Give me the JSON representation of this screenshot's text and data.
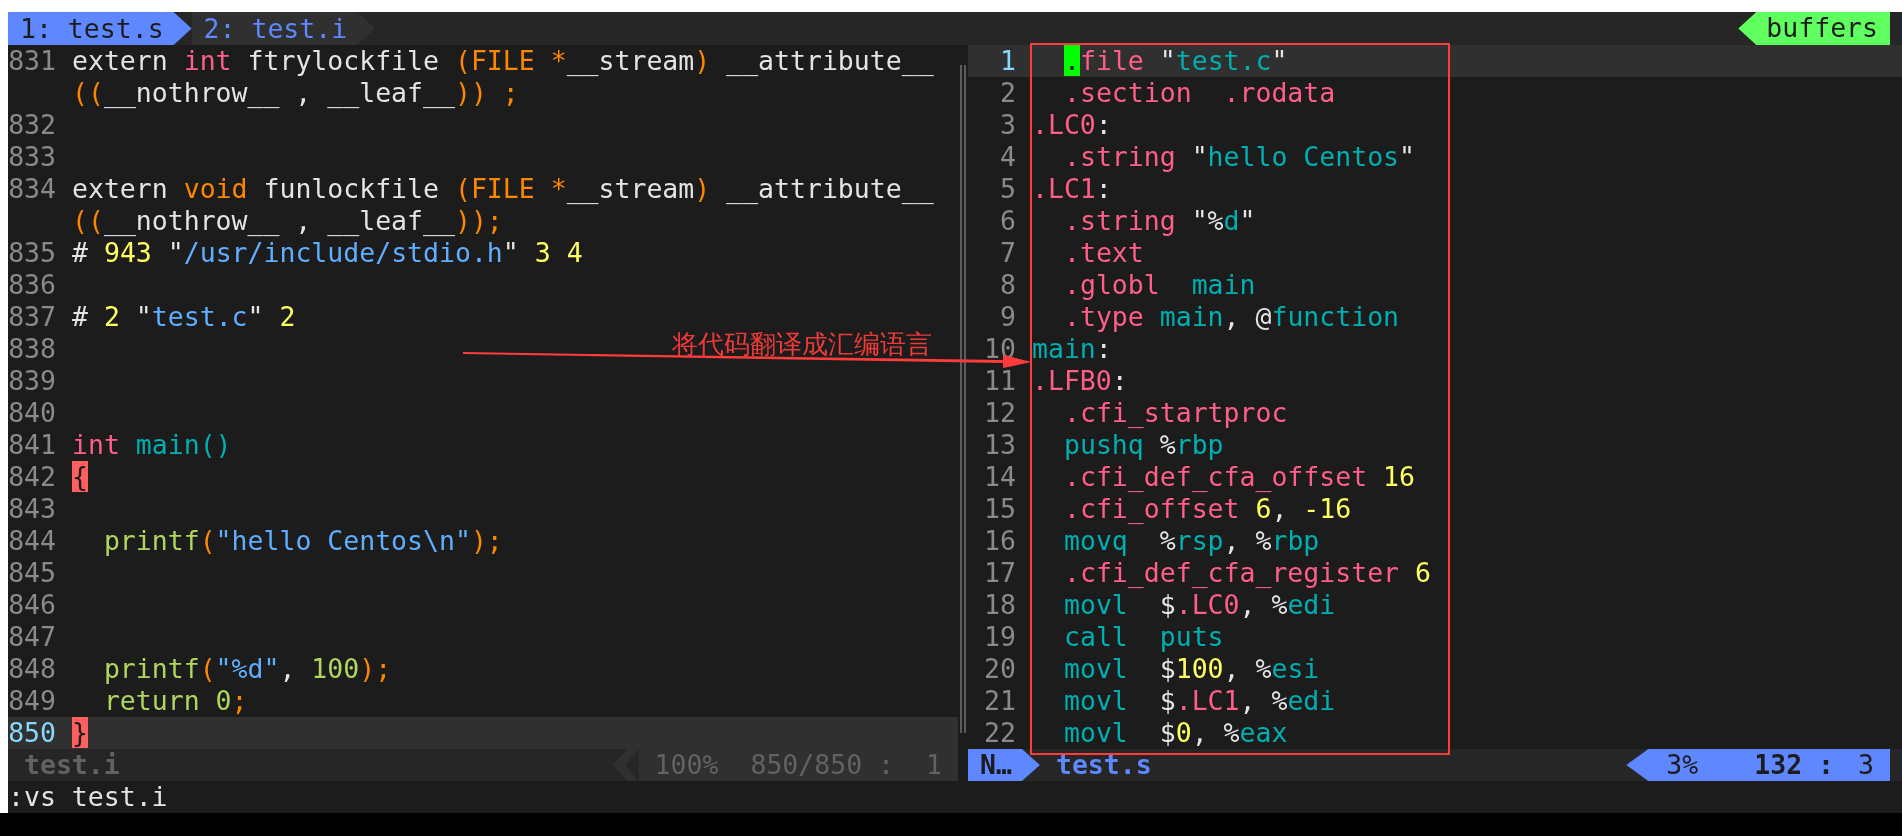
{
  "tabline": {
    "tabs": [
      {
        "label": "1: test.s",
        "selected": true
      },
      {
        "label": "2: test.i",
        "selected": false
      }
    ],
    "buffers_label": "buffers"
  },
  "left_pane": {
    "lines": [
      {
        "number": "831",
        "current": false,
        "segments": [
          {
            "tokens": [
              {
                "kind": "plain",
                "text": "extern "
              },
              {
                "kind": "pink",
                "text": "int"
              },
              {
                "kind": "plain",
                "text": " ftrylockfile "
              },
              {
                "kind": "orange",
                "text": "(FILE *"
              },
              {
                "kind": "plain",
                "text": "__stream"
              },
              {
                "kind": "orange",
                "text": ")"
              },
              {
                "kind": "plain",
                "text": " __attribute__"
              }
            ]
          },
          {
            "tokens": [
              {
                "kind": "orange",
                "text": "(("
              },
              {
                "kind": "plain",
                "text": "__nothrow__ , __leaf__"
              },
              {
                "kind": "orange",
                "text": ")) ;"
              }
            ]
          }
        ]
      },
      {
        "number": "832",
        "current": false
      },
      {
        "number": "833",
        "current": false
      },
      {
        "number": "834",
        "current": false,
        "segments": [
          {
            "tokens": [
              {
                "kind": "plain",
                "text": "extern "
              },
              {
                "kind": "orange",
                "text": "void"
              },
              {
                "kind": "plain",
                "text": " funlockfile "
              },
              {
                "kind": "orange",
                "text": "(FILE *"
              },
              {
                "kind": "plain",
                "text": "__stream"
              },
              {
                "kind": "orange",
                "text": ")"
              },
              {
                "kind": "plain",
                "text": " __attribute__"
              }
            ]
          },
          {
            "tokens": [
              {
                "kind": "orange",
                "text": "(("
              },
              {
                "kind": "plain",
                "text": "__nothrow__ , __leaf__"
              },
              {
                "kind": "orange",
                "text": "));"
              }
            ]
          }
        ]
      },
      {
        "number": "835",
        "current": false,
        "segments": [
          {
            "tokens": [
              {
                "kind": "plain",
                "text": "# "
              },
              {
                "kind": "yellow",
                "text": "943"
              },
              {
                "kind": "plain",
                "text": " \""
              },
              {
                "kind": "blue",
                "text": "/usr/include/stdio.h"
              },
              {
                "kind": "plain",
                "text": "\" "
              },
              {
                "kind": "yellow",
                "text": "3 4"
              }
            ]
          }
        ]
      },
      {
        "number": "836",
        "current": false
      },
      {
        "number": "837",
        "current": false,
        "segments": [
          {
            "tokens": [
              {
                "kind": "plain",
                "text": "# "
              },
              {
                "kind": "yellow",
                "text": "2"
              },
              {
                "kind": "plain",
                "text": " \""
              },
              {
                "kind": "blue",
                "text": "test.c"
              },
              {
                "kind": "plain",
                "text": "\" "
              },
              {
                "kind": "yellow",
                "text": "2"
              }
            ]
          }
        ]
      },
      {
        "number": "838",
        "current": false
      },
      {
        "number": "839",
        "current": false
      },
      {
        "number": "840",
        "current": false
      },
      {
        "number": "841",
        "current": false,
        "segments": [
          {
            "tokens": [
              {
                "kind": "pink",
                "text": "int"
              },
              {
                "kind": "teal",
                "text": " main()"
              }
            ]
          }
        ]
      },
      {
        "number": "842",
        "current": false,
        "segments": [
          {
            "tokens": [
              {
                "kind": "match",
                "text": "{"
              }
            ]
          }
        ]
      },
      {
        "number": "843",
        "current": false
      },
      {
        "number": "844",
        "current": false,
        "segments": [
          {
            "tokens": [
              {
                "kind": "green",
                "text": "  printf"
              },
              {
                "kind": "orange",
                "text": "("
              },
              {
                "kind": "blue",
                "text": "\"hello Centos\\n\""
              },
              {
                "kind": "orange",
                "text": ");"
              }
            ]
          }
        ]
      },
      {
        "number": "845",
        "current": false
      },
      {
        "number": "846",
        "current": false
      },
      {
        "number": "847",
        "current": false
      },
      {
        "number": "848",
        "current": false,
        "segments": [
          {
            "tokens": [
              {
                "kind": "green",
                "text": "  printf"
              },
              {
                "kind": "orange",
                "text": "("
              },
              {
                "kind": "blue",
                "text": "\"%d\""
              },
              {
                "kind": "plain",
                "text": ", "
              },
              {
                "kind": "green",
                "text": "100"
              },
              {
                "kind": "orange",
                "text": ");"
              }
            ]
          }
        ]
      },
      {
        "number": "849",
        "current": false,
        "segments": [
          {
            "tokens": [
              {
                "kind": "green",
                "text": "  return 0"
              },
              {
                "kind": "orange",
                "text": ";"
              }
            ]
          }
        ]
      },
      {
        "number": "850",
        "current": true,
        "segments": [
          {
            "tokens": [
              {
                "kind": "match",
                "text": "}"
              }
            ]
          }
        ]
      }
    ]
  },
  "right_pane": {
    "lines": [
      {
        "number": "1",
        "current": true,
        "indented": true,
        "segments": [
          {
            "tokens": [
              {
                "kind": "cursor",
                "text": "."
              },
              {
                "kind": "pink",
                "text": "file"
              },
              {
                "kind": "plain",
                "text": " \""
              },
              {
                "kind": "teal",
                "text": "test.c"
              },
              {
                "kind": "plain",
                "text": "\""
              }
            ]
          }
        ]
      },
      {
        "number": "2",
        "current": false,
        "indented": true,
        "segments": [
          {
            "tokens": [
              {
                "kind": "pink",
                "text": ".section  .rodata"
              }
            ]
          }
        ]
      },
      {
        "number": "3",
        "current": false,
        "indented": false,
        "segments": [
          {
            "tokens": [
              {
                "kind": "pink",
                "text": ".LC0"
              },
              {
                "kind": "plain",
                "text": ":"
              }
            ]
          }
        ]
      },
      {
        "number": "4",
        "current": false,
        "indented": true,
        "segments": [
          {
            "tokens": [
              {
                "kind": "pink",
                "text": ".string"
              },
              {
                "kind": "plain",
                "text": " \""
              },
              {
                "kind": "teal",
                "text": "hello Centos"
              },
              {
                "kind": "plain",
                "text": "\""
              }
            ]
          }
        ]
      },
      {
        "number": "5",
        "current": false,
        "indented": false,
        "segments": [
          {
            "tokens": [
              {
                "kind": "pink",
                "text": ".LC1"
              },
              {
                "kind": "plain",
                "text": ":"
              }
            ]
          }
        ]
      },
      {
        "number": "6",
        "current": false,
        "indented": true,
        "segments": [
          {
            "tokens": [
              {
                "kind": "pink",
                "text": ".string"
              },
              {
                "kind": "plain",
                "text": " \"%"
              },
              {
                "kind": "teal",
                "text": "d"
              },
              {
                "kind": "plain",
                "text": "\""
              }
            ]
          }
        ]
      },
      {
        "number": "7",
        "current": false,
        "indented": true,
        "segments": [
          {
            "tokens": [
              {
                "kind": "pink",
                "text": ".text"
              }
            ]
          }
        ]
      },
      {
        "number": "8",
        "current": false,
        "indented": true,
        "segments": [
          {
            "tokens": [
              {
                "kind": "pink",
                "text": ".globl"
              },
              {
                "kind": "teal",
                "text": "  main"
              }
            ]
          }
        ]
      },
      {
        "number": "9",
        "current": false,
        "indented": true,
        "segments": [
          {
            "tokens": [
              {
                "kind": "pink",
                "text": ".type"
              },
              {
                "kind": "teal",
                "text": " main"
              },
              {
                "kind": "plain",
                "text": ", @"
              },
              {
                "kind": "teal",
                "text": "function"
              }
            ]
          }
        ]
      },
      {
        "number": "10",
        "current": false,
        "indented": false,
        "segments": [
          {
            "tokens": [
              {
                "kind": "teal",
                "text": "main"
              },
              {
                "kind": "plain",
                "text": ":"
              }
            ]
          }
        ]
      },
      {
        "number": "11",
        "current": false,
        "indented": false,
        "segments": [
          {
            "tokens": [
              {
                "kind": "pink",
                "text": ".LFB0"
              },
              {
                "kind": "plain",
                "text": ":"
              }
            ]
          }
        ]
      },
      {
        "number": "12",
        "current": false,
        "indented": true,
        "segments": [
          {
            "tokens": [
              {
                "kind": "pink",
                "text": ".cfi_startproc"
              }
            ]
          }
        ]
      },
      {
        "number": "13",
        "current": false,
        "indented": true,
        "segments": [
          {
            "tokens": [
              {
                "kind": "teal",
                "text": "pushq"
              },
              {
                "kind": "plain",
                "text": " %"
              },
              {
                "kind": "teal",
                "text": "rbp"
              }
            ]
          }
        ]
      },
      {
        "number": "14",
        "current": false,
        "indented": true,
        "segments": [
          {
            "tokens": [
              {
                "kind": "pink",
                "text": ".cfi_def_cfa_offset"
              },
              {
                "kind": "yellow",
                "text": " 16"
              }
            ]
          }
        ]
      },
      {
        "number": "15",
        "current": false,
        "indented": true,
        "segments": [
          {
            "tokens": [
              {
                "kind": "pink",
                "text": ".cfi_offset"
              },
              {
                "kind": "yellow",
                "text": " 6"
              },
              {
                "kind": "plain",
                "text": ", "
              },
              {
                "kind": "yellow",
                "text": "-16"
              }
            ]
          }
        ]
      },
      {
        "number": "16",
        "current": false,
        "indented": true,
        "segments": [
          {
            "tokens": [
              {
                "kind": "teal",
                "text": "movq"
              },
              {
                "kind": "plain",
                "text": "  %"
              },
              {
                "kind": "teal",
                "text": "rsp"
              },
              {
                "kind": "plain",
                "text": ", %"
              },
              {
                "kind": "teal",
                "text": "rbp"
              }
            ]
          }
        ]
      },
      {
        "number": "17",
        "current": false,
        "indented": true,
        "segments": [
          {
            "tokens": [
              {
                "kind": "pink",
                "text": ".cfi_def_cfa_register"
              },
              {
                "kind": "yellow",
                "text": " 6"
              }
            ]
          }
        ]
      },
      {
        "number": "18",
        "current": false,
        "indented": true,
        "segments": [
          {
            "tokens": [
              {
                "kind": "teal",
                "text": "movl"
              },
              {
                "kind": "plain",
                "text": "  $"
              },
              {
                "kind": "pink",
                "text": ".LC0"
              },
              {
                "kind": "plain",
                "text": ", %"
              },
              {
                "kind": "teal",
                "text": "edi"
              }
            ]
          }
        ]
      },
      {
        "number": "19",
        "current": false,
        "indented": true,
        "segments": [
          {
            "tokens": [
              {
                "kind": "teal",
                "text": "call  puts"
              }
            ]
          }
        ]
      },
      {
        "number": "20",
        "current": false,
        "indented": true,
        "segments": [
          {
            "tokens": [
              {
                "kind": "teal",
                "text": "movl"
              },
              {
                "kind": "plain",
                "text": "  $"
              },
              {
                "kind": "yellow",
                "text": "100"
              },
              {
                "kind": "plain",
                "text": ", %"
              },
              {
                "kind": "teal",
                "text": "esi"
              }
            ]
          }
        ]
      },
      {
        "number": "21",
        "current": false,
        "indented": true,
        "segments": [
          {
            "tokens": [
              {
                "kind": "teal",
                "text": "movl"
              },
              {
                "kind": "plain",
                "text": "  $"
              },
              {
                "kind": "pink",
                "text": ".LC1"
              },
              {
                "kind": "plain",
                "text": ", %"
              },
              {
                "kind": "teal",
                "text": "edi"
              }
            ]
          }
        ]
      },
      {
        "number": "22",
        "current": false,
        "indented": true,
        "segments": [
          {
            "tokens": [
              {
                "kind": "teal",
                "text": "movl"
              },
              {
                "kind": "plain",
                "text": "  $"
              },
              {
                "kind": "yellow",
                "text": "0"
              },
              {
                "kind": "plain",
                "text": ", %"
              },
              {
                "kind": "teal",
                "text": "eax"
              }
            ]
          }
        ]
      }
    ]
  },
  "left_status": {
    "active": false,
    "filename": "test.i",
    "percent": "100%",
    "position": "850/850 :",
    "column": "1"
  },
  "right_status": {
    "active": true,
    "mode": "N…",
    "filename": "test.s",
    "percent": "3%",
    "position": "132 :",
    "column": "3"
  },
  "command_line": ":vs test.i",
  "annotation": {
    "label": "将代码翻译成汇编语言"
  }
}
